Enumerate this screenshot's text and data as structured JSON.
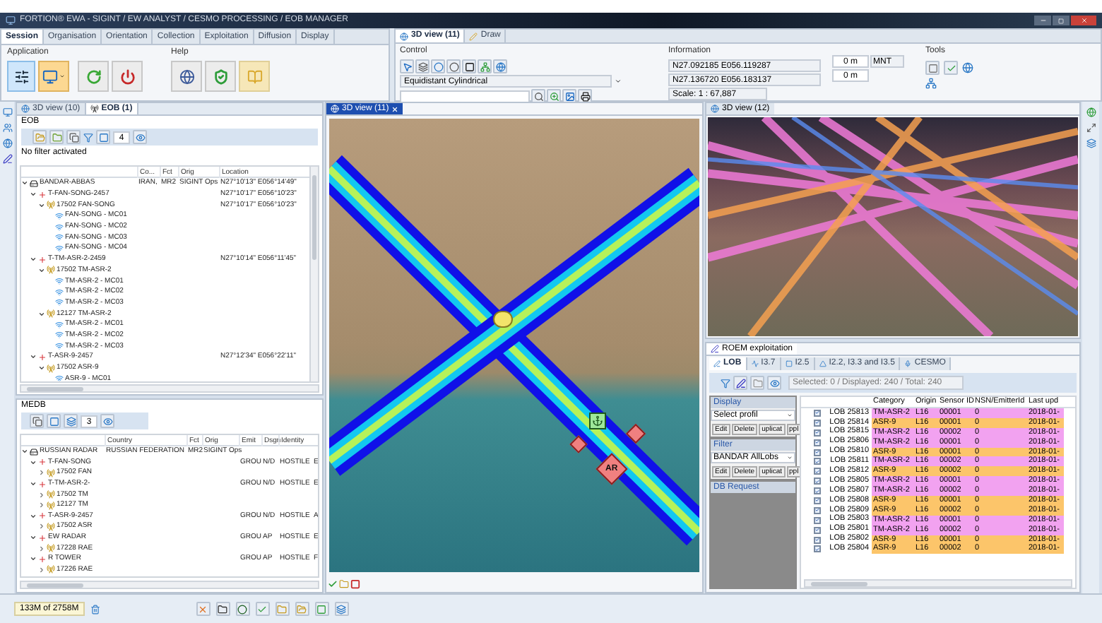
{
  "window": {
    "title": "FORTION® EWA - SIGINT / EW ANALYST / CESMO PROCESSING / EOB MANAGER"
  },
  "ribbon": {
    "tabs": [
      {
        "label": "Session",
        "selected": true
      },
      {
        "label": "Organisation",
        "selected": false
      },
      {
        "label": "Orientation",
        "selected": false
      },
      {
        "label": "Collection",
        "selected": false
      },
      {
        "label": "Exploitation",
        "selected": false
      },
      {
        "label": "Diffusion",
        "selected": false
      },
      {
        "label": "Display",
        "selected": false
      }
    ],
    "groups": [
      {
        "label": "Application"
      },
      {
        "label": "Help"
      }
    ]
  },
  "view_ribbon": {
    "tabs": [
      {
        "label": "3D view (11)",
        "selected": true
      },
      {
        "label": "Draw",
        "selected": false
      }
    ],
    "control": {
      "label": "Control",
      "projection": "Equidistant Cylindrical"
    },
    "information": {
      "label": "Information",
      "coord_1": "N27.092185 E056.119287",
      "coord_2": "N27.136720 E056.183137",
      "scale": "Scale: 1 : 67,887",
      "altitude_1": "0 m",
      "altitude_2": "0 m",
      "reference": "MNT"
    },
    "tools": {
      "label": "Tools"
    }
  },
  "left_panel": {
    "tabs": [
      {
        "label": "3D view (10)",
        "selected": false
      },
      {
        "label": "EOB (1)",
        "selected": true
      }
    ],
    "eob": {
      "title": "EOB",
      "spinner_value": "4",
      "filter_status": "No filter activated",
      "columns": [
        "Co...",
        "Fct",
        "Orig",
        "Location"
      ],
      "tree": [
        {
          "label": "BANDAR-ABBAS",
          "kind": "site",
          "expanded": true,
          "country": "IRAN,",
          "fct": "MR2",
          "orig": "SIGINT Ops",
          "location": "N27°10'13\" E056°14'49\"",
          "children": [
            {
              "label": "T-FAN-SONG-2457",
              "kind": "emitter",
              "expanded": true,
              "location": "N27°10'17\" E056°10'23\"",
              "children": [
                {
                  "label": "17502 FAN-SONG",
                  "kind": "sensor",
                  "expanded": true,
                  "location": "N27°10'17\" E056°10'23\"",
                  "children": [
                    {
                      "label": "FAN-SONG - MC01",
                      "kind": "mode"
                    },
                    {
                      "label": "FAN-SONG - MC02",
                      "kind": "mode"
                    },
                    {
                      "label": "FAN-SONG - MC03",
                      "kind": "mode"
                    },
                    {
                      "label": "FAN-SONG - MC04",
                      "kind": "mode"
                    }
                  ]
                }
              ]
            },
            {
              "label": "T-TM-ASR-2-2459",
              "kind": "emitter",
              "expanded": true,
              "location": "N27°10'14\" E056°11'45\"",
              "children": [
                {
                  "label": "17502 TM-ASR-2",
                  "kind": "sensor",
                  "expanded": true,
                  "children": [
                    {
                      "label": "TM-ASR-2 - MC01",
                      "kind": "mode"
                    },
                    {
                      "label": "TM-ASR-2 - MC02",
                      "kind": "mode"
                    },
                    {
                      "label": "TM-ASR-2 - MC03",
                      "kind": "mode"
                    }
                  ]
                },
                {
                  "label": "12127 TM-ASR-2",
                  "kind": "sensor",
                  "expanded": true,
                  "children": [
                    {
                      "label": "TM-ASR-2 - MC01",
                      "kind": "mode"
                    },
                    {
                      "label": "TM-ASR-2 - MC02",
                      "kind": "mode"
                    },
                    {
                      "label": "TM-ASR-2 - MC03",
                      "kind": "mode"
                    }
                  ]
                }
              ]
            },
            {
              "label": "T-ASR-9-2457",
              "kind": "emitter",
              "expanded": true,
              "location": "N27°12'34\" E056°22'11\"",
              "children": [
                {
                  "label": "17502 ASR-9",
                  "kind": "sensor",
                  "expanded": true,
                  "children": [
                    {
                      "label": "ASR-9 - MC01",
                      "kind": "mode"
                    }
                  ]
                }
              ]
            }
          ]
        }
      ]
    },
    "medb": {
      "title": "MEDB",
      "spinner_value": "3",
      "columns": [
        "Country",
        "Fct",
        "Orig",
        "Emit",
        "Dsgn",
        "Identity"
      ],
      "tree": [
        {
          "label": "RUSSIAN RADAR",
          "kind": "site",
          "expanded": true,
          "country": "RUSSIAN FEDERATION",
          "fct": "MR2",
          "orig": "SIGINT Ops",
          "children": [
            {
              "label": "T-FAN-SONG",
              "kind": "emitter",
              "expanded": true,
              "emit": "GROU",
              "dsgn": "N/D",
              "identity": "HOSTILE",
              "column_7": "E",
              "children": [
                {
                  "label": "17502 FAN",
                  "kind": "sensor",
                  "expanded": false
                }
              ]
            },
            {
              "label": "T-TM-ASR-2-",
              "kind": "emitter",
              "expanded": true,
              "emit": "GROU",
              "dsgn": "N/D",
              "identity": "HOSTILE",
              "column_7": "E",
              "children": [
                {
                  "label": "17502 TM",
                  "kind": "sensor",
                  "expanded": false
                },
                {
                  "label": "12127 TM",
                  "kind": "sensor",
                  "expanded": false
                }
              ]
            },
            {
              "label": "T-ASR-9-2457",
              "kind": "emitter",
              "expanded": true,
              "emit": "GROU",
              "dsgn": "N/D",
              "identity": "HOSTILE",
              "column_7": "A",
              "children": [
                {
                  "label": "17502 ASR",
                  "kind": "sensor",
                  "expanded": false
                }
              ]
            },
            {
              "label": "EW RADAR",
              "kind": "emitter",
              "expanded": true,
              "emit": "GROU",
              "dsgn": "AP",
              "identity": "HOSTILE",
              "column_7": "E",
              "children": [
                {
                  "label": "17228 RAE",
                  "kind": "sensor",
                  "expanded": false
                }
              ]
            },
            {
              "label": "R TOWER",
              "kind": "emitter",
              "expanded": true,
              "emit": "GROU",
              "dsgn": "AP",
              "identity": "HOSTILE",
              "column_7": "F",
              "children": [
                {
                  "label": "17226 RAE",
                  "kind": "sensor",
                  "expanded": false
                }
              ]
            }
          ]
        }
      ]
    }
  },
  "map_view": {
    "tab": "3D view (11)",
    "markers": [
      {
        "label": "AR"
      }
    ]
  },
  "scene_view": {
    "tab": "3D view (12)"
  },
  "roem": {
    "title": "ROEM exploitation",
    "tabs": [
      {
        "label": "LOB",
        "selected": true
      },
      {
        "label": "I3.7",
        "selected": false
      },
      {
        "label": "I2.5",
        "selected": false
      },
      {
        "label": "I2.2, I3.3 and I3.5",
        "selected": false
      },
      {
        "label": "CESMO",
        "selected": false
      }
    ],
    "selection_status": "Selected: 0 / Displayed: 240 / Total: 240",
    "sections": [
      {
        "title": "Display",
        "select": "Select profil",
        "buttons": [
          "Edit",
          "Delete",
          "uplicat",
          "ppl"
        ]
      },
      {
        "title": "Filter",
        "select": "BANDAR AllLobs",
        "buttons": [
          "Edit",
          "Delete",
          "uplicat",
          "ppl"
        ]
      },
      {
        "title": "DB Request"
      }
    ],
    "columns": [
      "Category",
      "Origin",
      "Sensor ID",
      "NSN/EmitterId",
      "Last upd"
    ],
    "rows": [
      {
        "checked": true,
        "id": "LOB 25813",
        "category": "TM-ASR-2",
        "origin": "L16",
        "sensor_id": "00001",
        "nsn": "0",
        "last_update": "2018-01-",
        "color": "#f2a2f0"
      },
      {
        "checked": true,
        "id": "LOB 25814",
        "category": "ASR-9",
        "origin": "L16",
        "sensor_id": "00001",
        "nsn": "0",
        "last_update": "2018-01-",
        "color": "#fcc56a"
      },
      {
        "checked": true,
        "id": "LOB 25815",
        "category": "TM-ASR-2",
        "origin": "L16",
        "sensor_id": "00002",
        "nsn": "0",
        "last_update": "2018-01-",
        "color": "#f2a2f0"
      },
      {
        "checked": true,
        "id": "LOB 25806",
        "category": "TM-ASR-2",
        "origin": "L16",
        "sensor_id": "00001",
        "nsn": "0",
        "last_update": "2018-01-",
        "color": "#f2a2f0"
      },
      {
        "checked": true,
        "id": "LOB 25810",
        "category": "ASR-9",
        "origin": "L16",
        "sensor_id": "00001",
        "nsn": "0",
        "last_update": "2018-01-",
        "color": "#fcc56a"
      },
      {
        "checked": true,
        "id": "LOB 25811",
        "category": "TM-ASR-2",
        "origin": "L16",
        "sensor_id": "00002",
        "nsn": "0",
        "last_update": "2018-01-",
        "color": "#f2a2f0"
      },
      {
        "checked": true,
        "id": "LOB 25812",
        "category": "ASR-9",
        "origin": "L16",
        "sensor_id": "00002",
        "nsn": "0",
        "last_update": "2018-01-",
        "color": "#fcc56a"
      },
      {
        "checked": true,
        "id": "LOB 25805",
        "category": "TM-ASR-2",
        "origin": "L16",
        "sensor_id": "00001",
        "nsn": "0",
        "last_update": "2018-01-",
        "color": "#f2a2f0"
      },
      {
        "checked": true,
        "id": "LOB 25807",
        "category": "TM-ASR-2",
        "origin": "L16",
        "sensor_id": "00002",
        "nsn": "0",
        "last_update": "2018-01-",
        "color": "#f2a2f0"
      },
      {
        "checked": true,
        "id": "LOB 25808",
        "category": "ASR-9",
        "origin": "L16",
        "sensor_id": "00001",
        "nsn": "0",
        "last_update": "2018-01-",
        "color": "#fcc56a"
      },
      {
        "checked": true,
        "id": "LOB 25809",
        "category": "ASR-9",
        "origin": "L16",
        "sensor_id": "00002",
        "nsn": "0",
        "last_update": "2018-01-",
        "color": "#fcc56a"
      },
      {
        "checked": true,
        "id": "LOB 25803",
        "category": "TM-ASR-2",
        "origin": "L16",
        "sensor_id": "00001",
        "nsn": "0",
        "last_update": "2018-01-",
        "color": "#f2a2f0"
      },
      {
        "checked": true,
        "id": "LOB 25801",
        "category": "TM-ASR-2",
        "origin": "L16",
        "sensor_id": "00002",
        "nsn": "0",
        "last_update": "2018-01-",
        "color": "#f2a2f0"
      },
      {
        "checked": true,
        "id": "LOB 25802",
        "category": "ASR-9",
        "origin": "L16",
        "sensor_id": "00001",
        "nsn": "0",
        "last_update": "2018-01-",
        "color": "#fcc56a"
      },
      {
        "checked": true,
        "id": "LOB 25804",
        "category": "ASR-9",
        "origin": "L16",
        "sensor_id": "00002",
        "nsn": "0",
        "last_update": "2018-01-",
        "color": "#fcc56a"
      }
    ]
  },
  "status_bar": {
    "memory": "133M of 2758M"
  }
}
